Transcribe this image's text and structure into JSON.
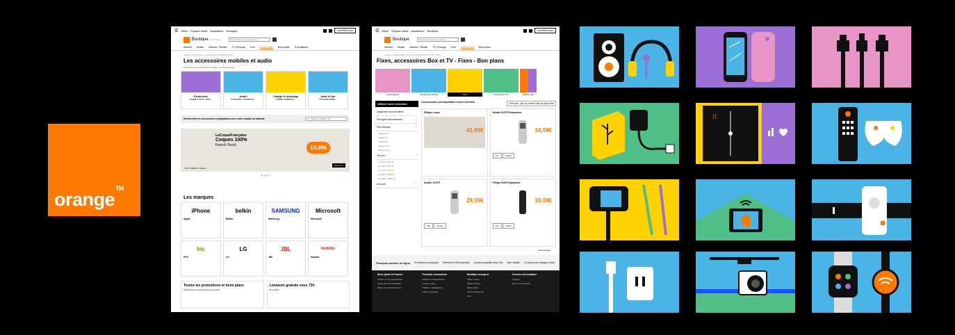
{
  "brand": {
    "logo_text": "orange",
    "trademark": "TM",
    "color": "#ff7900"
  },
  "page1": {
    "topbar": {
      "menu": "Menu",
      "links": [
        "Espace client",
        "Assistance",
        "Boutique"
      ],
      "button": "Identifiez-vous"
    },
    "brand_name": "Boutique",
    "brand_sub": "Particuliers",
    "search_placeholder": "Recherchez dans la boutique",
    "nav": [
      "Internet",
      "Mobile",
      "Internet + Mobile",
      "TV d'Orange",
      "Fixe",
      "Accessoires",
      "Bons plans",
      "E-Boutiques"
    ],
    "active_nav": "Accessoires",
    "breadcrumb": "Orange > Accessoires > Accessoires mobiles et audio",
    "title": "Les accessoires mobiles et audio",
    "subtitle": "La boutique des accessoires mobiles et audio d'Orange",
    "categories": [
      {
        "label": "Protection",
        "sub": "Coques, étuis, films...",
        "color": "#9b6fd6"
      },
      {
        "label": "Audio",
        "sub": "Enceintes, écouteurs...",
        "color": "#4bb4e6"
      },
      {
        "label": "Charge & stockage",
        "sub": "Câbles, batteries...",
        "color": "#ffd200"
      },
      {
        "label": "Auto et fun",
        "sub": "Perches selfie...",
        "color": "#4bb4e6"
      }
    ],
    "compat_label": "Rechercher les accessoires compatibles avec votre mobile ou tablette",
    "compat_placeholder": "Ex. iPhone 6, Galaxy S6...",
    "banner": {
      "brand": "LaCoqueFrançaise",
      "title": "Coques 100%",
      "subtitle": "French Touch",
      "price": "19,99€",
      "made": "100 % Made in France",
      "cta": "Découvrir"
    },
    "brands_title": "Les marques",
    "brands": [
      {
        "logo": " iPhone",
        "name": "Apple"
      },
      {
        "logo": "belkin",
        "name": "Belkin"
      },
      {
        "logo": "SAMSUNG",
        "name": "Samsung"
      },
      {
        "logo": "Microsoft",
        "name": "Microsoft"
      },
      {
        "logo": "htc",
        "name": "HTC"
      },
      {
        "logo": "LG",
        "name": "LG"
      },
      {
        "logo": "JBL",
        "name": "JBL"
      },
      {
        "logo": "HUAWEI",
        "name": "Huawei"
      }
    ],
    "promo_left": "Toutes les promotions et bons plans",
    "promo_left_link": "Découvrir les promotions et bons plans",
    "promo_right": "Livraison gratuite sous 72h",
    "promo_right_link": "En profiter"
  },
  "page2": {
    "title": "Fixes, accessoires Box et TV - Fixes - Bon plans",
    "breadcrumb": "Orange > Accessoires > Fixes, accessoires box et TV > Fixes",
    "tiles": [
      {
        "label": "Connectiques",
        "color": "#e794c6"
      },
      {
        "label": "Accessoires de Box",
        "color": "#4bb4e6"
      },
      {
        "label": "Fixes",
        "color": "#ffd200"
      },
      {
        "label": "Accessoires TV",
        "color": "#50be87"
      },
      {
        "label": "Afficher tout",
        "color": "#ff7900"
      }
    ],
    "filter_title": "Affinez votre sélection",
    "filter_clear": "Supprimer tous les filtres",
    "filters": [
      {
        "label": "Par types d'accessoires",
        "options": []
      },
      {
        "label": "Par marques",
        "options": [
          "Gigaset (4)",
          "Alcatel (3)",
          "Philips (2)",
          "Logicom (1)",
          "Samsung (1)"
        ]
      },
      {
        "label": "Par prix",
        "options": [
          "moins de 10€ (3)",
          "de 10€ à 30€ (6)",
          "de 30€ à 50€ (3)",
          "de 50€ à 100€ (2)",
          "de 100€ à 200€ (1)"
        ]
      },
      {
        "label": "À la une",
        "options": []
      }
    ],
    "count_text": "4 accessoires correspondant à votre sélection",
    "sort_label": "Trier par : prix du moins cher au plus cher",
    "products": [
      {
        "name": "Philips Lucas",
        "price": "41,99€",
        "btn1": "",
        "btn2": ""
      },
      {
        "name": "Alcatel XL575 Répondeur",
        "price": "34,99€",
        "btn1": "Voir",
        "btn2": "Choisir"
      },
      {
        "name": "Alcatel XL375",
        "price": "29,99€",
        "btn1": "Voir",
        "btn2": "Choisir"
      },
      {
        "name": "Philips D150 Répondeur",
        "price": "39,99€",
        "btn1": "Voir",
        "btn2": "Choisir"
      }
    ],
    "pager": "Haut de page",
    "assurance_title": "Pourquoi acheter en ligne",
    "assurances": [
      "Promotions exclusives",
      "Paiement 100% sécurisé",
      "Livraison gratuite sous 72h",
      "Avis vérifiés",
      "21 jours pour changer d'avis"
    ],
    "footer": [
      {
        "title": "Bons plans & Promos",
        "items": [
          "Soldes sur les accessoires",
          "Sports iPhone accessible",
          "Offres de remboursement"
        ]
      },
      {
        "title": "Produits consommés",
        "items": [
          "Mobiles et Smartphones",
          "Coques, étuis",
          "Câbles et adaptateurs",
          "Objets connectés"
        ]
      },
      {
        "title": "Boutique orange.fr",
        "items": [
          "Offres mobile",
          "Offres internet",
          "Offres Open",
          "Offres internet pro",
          "Fixe"
        ]
      },
      {
        "title": "Trouver une boutique",
        "items": [
          "Pratique",
          "Suivi de commande"
        ]
      }
    ]
  }
}
